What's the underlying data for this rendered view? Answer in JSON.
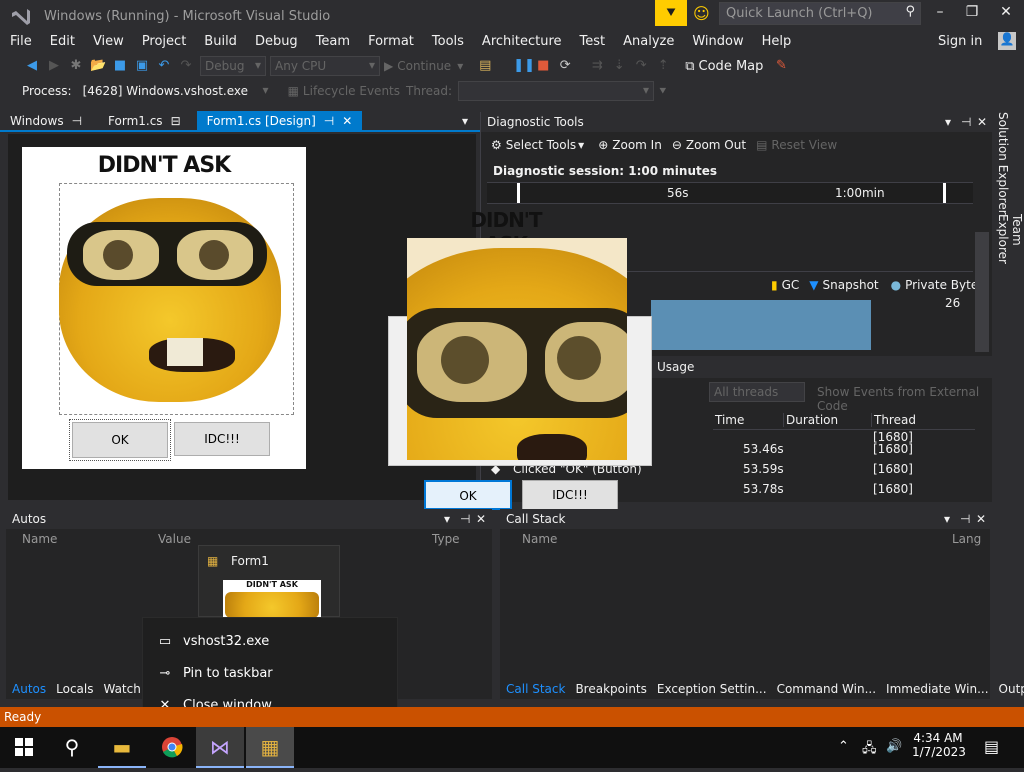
{
  "window": {
    "title": "Windows (Running) - Microsoft Visual Studio",
    "quick_launch_placeholder": "Quick Launch (Ctrl+Q)",
    "minimize": "–",
    "restore": "❐",
    "close": "✕"
  },
  "menu": {
    "items": [
      "File",
      "Edit",
      "View",
      "Project",
      "Build",
      "Debug",
      "Team",
      "Format",
      "Tools",
      "Architecture",
      "Test",
      "Analyze",
      "Window",
      "Help"
    ],
    "sign_in": "Sign in"
  },
  "toolbar": {
    "config": "Debug",
    "platform": "Any CPU",
    "continue": "Continue",
    "code_map": "Code Map"
  },
  "toolbar2": {
    "process_label": "Process:",
    "process_value": "[4628] Windows.vshost.exe",
    "lifecycle": "Lifecycle Events",
    "thread_label": "Thread:"
  },
  "tabs": [
    {
      "label": "Windows",
      "pin": "⊣"
    },
    {
      "label": "Form1.cs",
      "pin": "🔒"
    },
    {
      "label": "Form1.cs [Design]",
      "pin": "⊣"
    }
  ],
  "form_design": {
    "heading": "DIDN'T ASK",
    "ok": "OK",
    "idc": "IDC!!!"
  },
  "diagnostic": {
    "title": "Diagnostic Tools",
    "select_tools": "Select Tools",
    "zoom_in": "Zoom In",
    "zoom_out": "Zoom Out",
    "reset_view": "Reset View",
    "session": "Diagnostic session: 1:00 minutes",
    "ruler_56": "56s",
    "ruler_100": "1:00min",
    "legend_gc": "GC",
    "legend_snapshot": "Snapshot",
    "legend_private": "Private Bytes",
    "scale_value": "26",
    "usage_tab": "Usage",
    "all_threads": "All threads",
    "show_external": "Show Events from External Code",
    "col_time": "Time",
    "col_duration": "Duration",
    "col_thread": "Thread",
    "rows": [
      {
        "event": "",
        "time": "53.46s",
        "thread": "[1680]"
      },
      {
        "event": "Clicked \"OK\" (Button)",
        "time": "53.59s",
        "thread": "[1680]"
      },
      {
        "event": "",
        "time": "53.78s",
        "thread": "[1680]"
      }
    ],
    "partial_row_thread": "[1680]"
  },
  "floating_dialog": {
    "heading": "DIDN'T ASK",
    "ok": "OK",
    "idc": "IDC!!!"
  },
  "autos": {
    "title": "Autos",
    "col_name": "Name",
    "col_value": "Value",
    "col_type": "Type",
    "tabs": [
      "Autos",
      "Locals",
      "Watch 1"
    ]
  },
  "callstack": {
    "title": "Call Stack",
    "col_name": "Name",
    "col_lang": "Lang",
    "tabs": [
      "Call Stack",
      "Breakpoints",
      "Exception Settin...",
      "Command Win...",
      "Immediate Win...",
      "Output"
    ]
  },
  "thumbnail": {
    "title": "Form1",
    "heading": "DIDN'T ASK"
  },
  "jumplist": {
    "items": [
      {
        "icon": "app-window-icon",
        "label": "vshost32.exe"
      },
      {
        "icon": "pin-icon",
        "label": "Pin to taskbar"
      },
      {
        "icon": "close-icon",
        "label": "Close window"
      }
    ]
  },
  "side_tabs": [
    "Solution Explorer",
    "Team Explorer"
  ],
  "status": {
    "text": "Ready"
  },
  "taskbar": {
    "time": "4:34 AM",
    "date": "1/7/2023"
  },
  "colors": {
    "accent": "#007acc",
    "status": "#ca5100",
    "filter": "#ffcc00"
  }
}
